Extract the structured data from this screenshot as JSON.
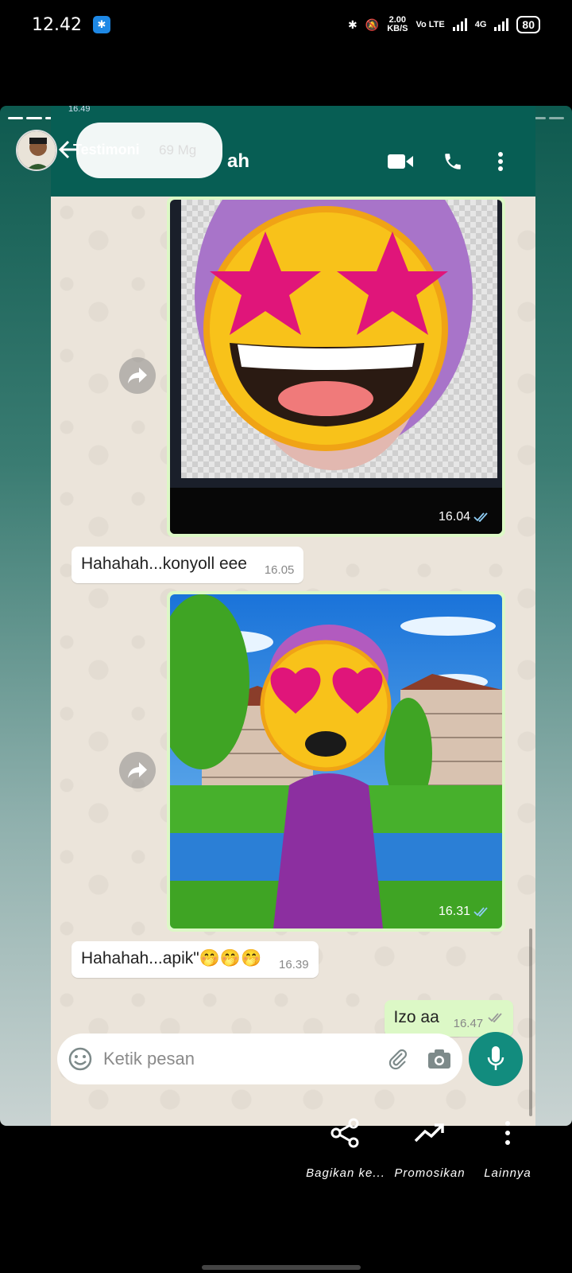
{
  "status_bar": {
    "time": "12.42",
    "speed_value": "2.00",
    "speed_unit": "KB/S",
    "volte": "Vo LTE",
    "network": "4G",
    "battery": "80"
  },
  "story": {
    "title": "Testimoni",
    "age": "69 Mg"
  },
  "wa_screenshot": {
    "contact_suffix": "ah",
    "status_time": "16.49",
    "messages": [
      {
        "type": "image",
        "time": "16.04"
      },
      {
        "type": "text_in",
        "text": "Hahahah...konyoll eee",
        "time": "16.05"
      },
      {
        "type": "image",
        "time": "16.31"
      },
      {
        "type": "text_in",
        "text": "Hahahah...apik\"🤭🤭🤭",
        "time": "16.39"
      },
      {
        "type": "text_out",
        "text": "Izo aa",
        "time": "16.47"
      }
    ],
    "composer_placeholder": "Ketik pesan"
  },
  "actions": [
    {
      "label": "Bagikan ke...",
      "icon": "share-icon"
    },
    {
      "label": "Promosikan",
      "icon": "trending-up-icon"
    },
    {
      "label": "Lainnya",
      "icon": "more-vertical-icon"
    }
  ],
  "colors": {
    "wa_green": "#075e54",
    "outgoing_bubble": "#dcf8c6",
    "mic_button": "#128c7e"
  }
}
